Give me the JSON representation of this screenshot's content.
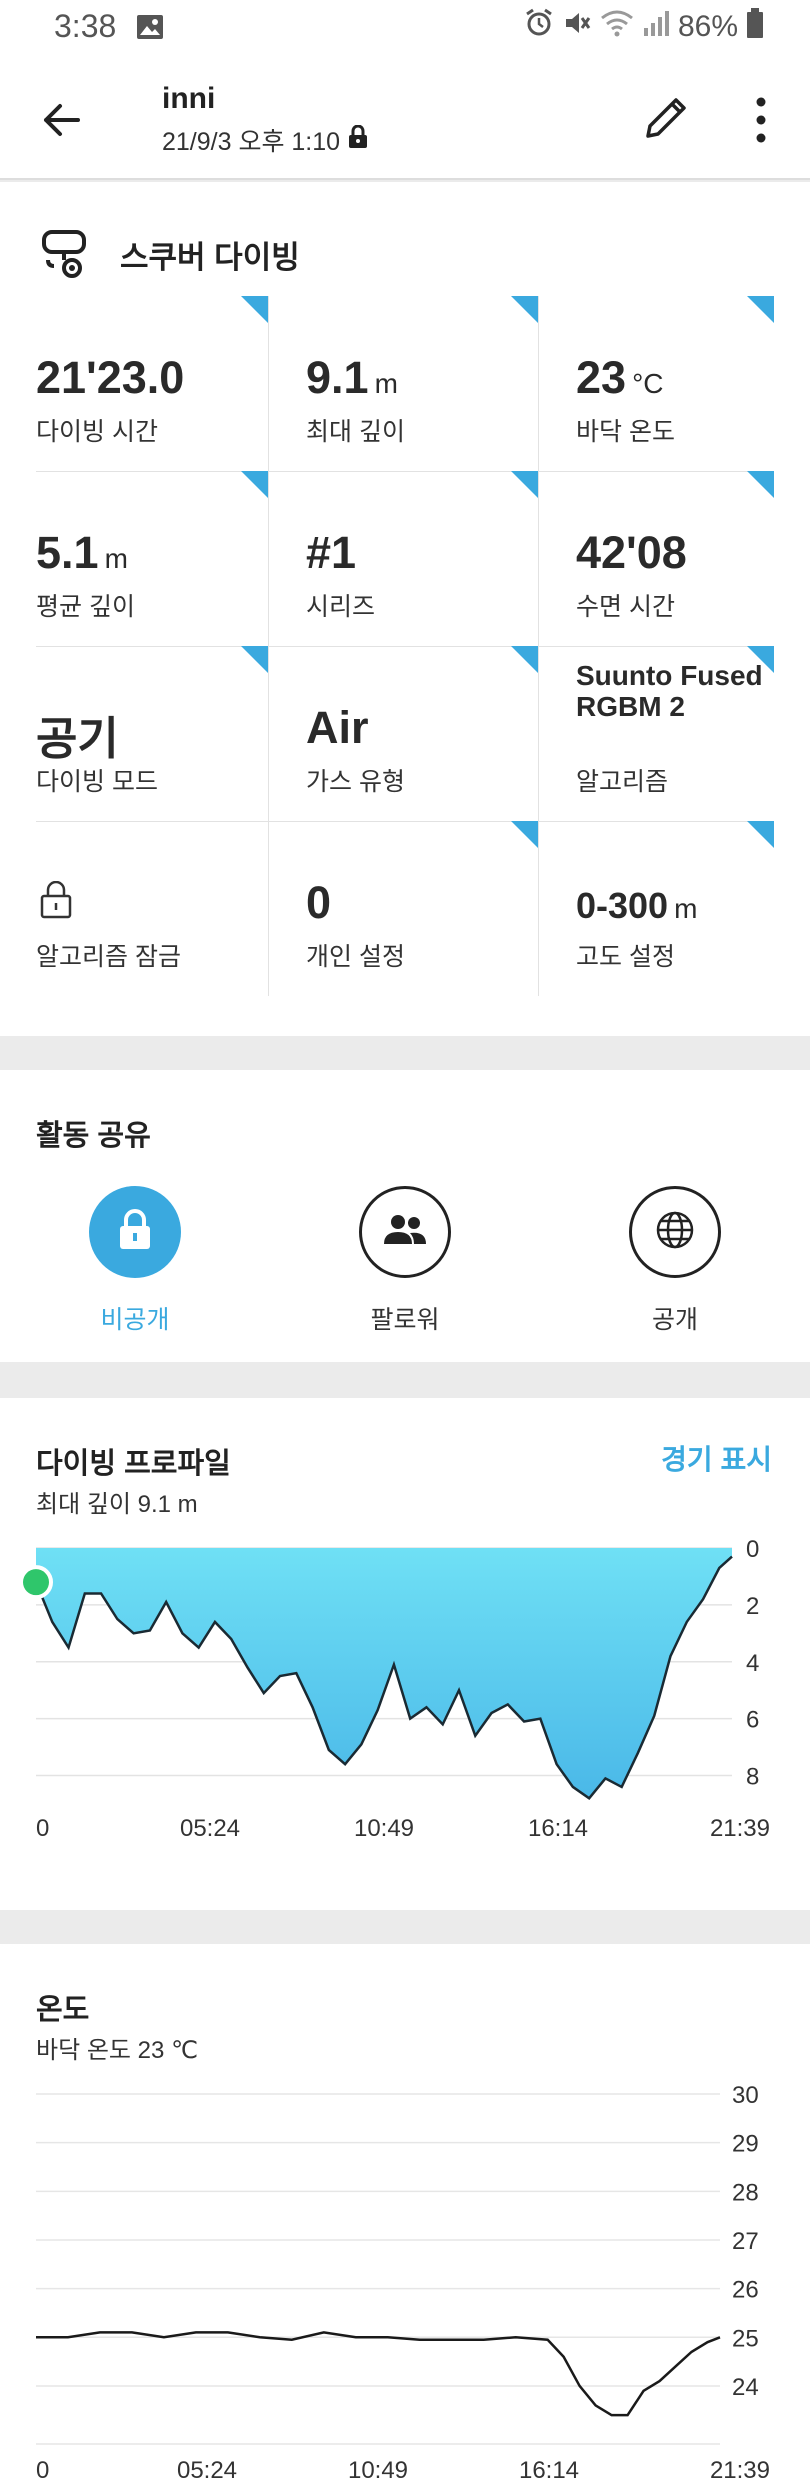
{
  "status": {
    "time": "3:38",
    "battery": "86%"
  },
  "header": {
    "title": "inni",
    "subtitle": "21/9/3 오후 1:10"
  },
  "activity": {
    "name": "스쿠버 다이빙"
  },
  "stats": [
    {
      "value": "21'23.0",
      "unit": "",
      "label": "다이빙 시간"
    },
    {
      "value": "9.1",
      "unit": "m",
      "label": "최대 깊이"
    },
    {
      "value": "23",
      "unit": "°C",
      "label": "바닥 온도"
    },
    {
      "value": "5.1",
      "unit": "m",
      "label": "평균 깊이"
    },
    {
      "value": "#1",
      "unit": "",
      "label": "시리즈"
    },
    {
      "value": "42'08",
      "unit": "",
      "label": "수면 시간"
    },
    {
      "value": "공기",
      "unit": "",
      "label": "다이빙 모드"
    },
    {
      "value": "Air",
      "unit": "",
      "label": "가스 유형"
    },
    {
      "value": "Suunto Fused RGBM 2",
      "unit": "",
      "label": "알고리즘"
    },
    {
      "value": "",
      "unit": "",
      "label": "알고리즘 잠금",
      "icon": "lock-icon"
    },
    {
      "value": "0",
      "unit": "",
      "label": "개인 설정"
    },
    {
      "value": "0-300",
      "unit": "m",
      "label": "고도 설정"
    }
  ],
  "share": {
    "title": "활동 공유",
    "options": [
      {
        "label": "비공개",
        "icon": "lock-icon",
        "selected": true
      },
      {
        "label": "팔로워",
        "icon": "followers-icon",
        "selected": false
      },
      {
        "label": "공개",
        "icon": "globe-icon",
        "selected": false
      }
    ]
  },
  "profile": {
    "title": "다이빙 프로파일",
    "subtitle": "최대 깊이 9.1 m",
    "link": "경기 표시"
  },
  "temperature": {
    "title": "온도",
    "subtitle": "바닥 온도 23 ℃"
  },
  "colors": {
    "accent": "#3aa9df",
    "depth_fill_top": "#6fe0f5",
    "depth_fill_bottom": "#4ab8e8",
    "start_dot": "#2fc66b"
  },
  "chart_data": [
    {
      "type": "area",
      "x_ticks": [
        "0",
        "05:24",
        "10:49",
        "16:14",
        "21:39"
      ],
      "y_ticks": [
        "0",
        "2",
        "4",
        "6",
        "8"
      ],
      "ylim": [
        0,
        9
      ],
      "y_reversed": true,
      "x": [
        0,
        0.5,
        1.0,
        1.5,
        2.0,
        2.5,
        3.0,
        3.5,
        4.0,
        4.5,
        5.0,
        5.5,
        6.0,
        6.5,
        7.0,
        7.5,
        8.0,
        8.5,
        9.0,
        9.5,
        10.0,
        10.5,
        11.0,
        11.5,
        12.0,
        12.5,
        13.0,
        13.5,
        14.0,
        14.5,
        15.0,
        15.5,
        16.0,
        16.5,
        17.0,
        17.5,
        18.0,
        18.5,
        19.0,
        19.5,
        20.0,
        20.5,
        21.0,
        21.39
      ],
      "values": [
        1.2,
        2.6,
        3.5,
        1.6,
        1.6,
        2.5,
        3.0,
        2.9,
        1.9,
        3.0,
        3.5,
        2.6,
        3.2,
        4.2,
        5.1,
        4.5,
        4.4,
        5.6,
        7.1,
        7.6,
        6.9,
        5.7,
        4.1,
        6.0,
        5.6,
        6.2,
        5.0,
        6.6,
        5.8,
        5.5,
        6.1,
        6.0,
        7.6,
        8.4,
        8.8,
        8.1,
        8.4,
        7.2,
        5.9,
        3.8,
        2.6,
        1.8,
        0.7,
        0.3
      ],
      "unit": "m"
    },
    {
      "type": "line",
      "x_ticks": [
        "0",
        "05:24",
        "10:49",
        "16:14",
        "21:39"
      ],
      "y_ticks": [
        "30",
        "29",
        "28",
        "27",
        "26",
        "25",
        "24"
      ],
      "ylim": [
        23.3,
        30
      ],
      "x": [
        0,
        1.0,
        2.0,
        3.0,
        4.0,
        5.0,
        6.0,
        7.0,
        8.0,
        9.0,
        10.0,
        11.0,
        12.0,
        13.0,
        14.0,
        15.0,
        16.0,
        16.5,
        17.0,
        17.5,
        18.0,
        18.5,
        19.0,
        19.5,
        20.0,
        20.5,
        21.0,
        21.39
      ],
      "values": [
        25.0,
        25.0,
        25.1,
        25.1,
        25.0,
        25.1,
        25.1,
        25.0,
        24.95,
        25.1,
        25.0,
        25.0,
        24.95,
        24.95,
        24.95,
        25.0,
        24.95,
        24.6,
        24.0,
        23.6,
        23.4,
        23.4,
        23.9,
        24.1,
        24.4,
        24.7,
        24.9,
        25.0
      ],
      "unit": "°C"
    }
  ]
}
